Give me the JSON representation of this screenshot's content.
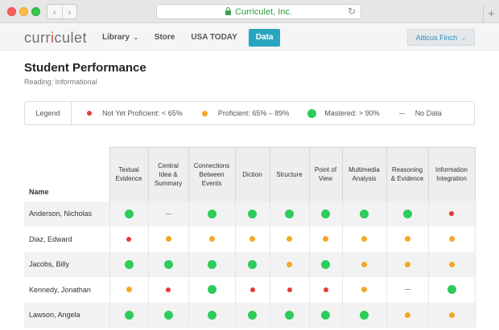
{
  "browser": {
    "url": "Curriculet, Inc.",
    "back_glyph": "‹",
    "forward_glyph": "›",
    "reload_glyph": "↻",
    "new_tab_glyph": "+"
  },
  "nav": {
    "logo_pre": "curr",
    "logo_accent": "i",
    "logo_post": "culet",
    "library": "Library",
    "store": "Store",
    "usa_today": "USA TODAY",
    "data": "Data",
    "user": "Atticus Finch",
    "caret": "⌄"
  },
  "page": {
    "title": "Student Performance",
    "subtitle": "Reading: Informational"
  },
  "legend": {
    "title": "Legend",
    "items": [
      {
        "mark": "red",
        "label": "Not Yet Proficient: < 65%"
      },
      {
        "mark": "yellow",
        "label": "Proficient: 65% – 89%"
      },
      {
        "mark": "green",
        "label": "Mastered: > 90%"
      },
      {
        "mark": "dash",
        "label": "No Data"
      }
    ]
  },
  "colors": {
    "red": "#e53935",
    "yellow": "#f5a623",
    "green": "#2ecc5a",
    "accent": "#29a6bf"
  },
  "table": {
    "name_header": "Name",
    "columns": [
      [
        "Textual",
        "Evidence"
      ],
      [
        "Central",
        "Idea &",
        "Summary"
      ],
      [
        "Connections",
        "Between",
        "Events"
      ],
      [
        "Diction"
      ],
      [
        "Structure"
      ],
      [
        "Point of",
        "View"
      ],
      [
        "Multimedia",
        "Analysis"
      ],
      [
        "Reasoning",
        "& Evidence"
      ],
      [
        "Information",
        "Integration"
      ]
    ],
    "rows": [
      {
        "name": "Anderson, Nicholas",
        "marks": [
          "green",
          "dash",
          "green",
          "green",
          "green",
          "green",
          "green",
          "green",
          "red"
        ]
      },
      {
        "name": "Diaz, Edward",
        "marks": [
          "red",
          "yellow",
          "yellow",
          "yellow",
          "yellow",
          "yellow",
          "yellow",
          "yellow",
          "yellow"
        ]
      },
      {
        "name": "Jacobs, Billy",
        "marks": [
          "green",
          "green",
          "green",
          "green",
          "yellow",
          "green",
          "yellow",
          "yellow",
          "yellow"
        ]
      },
      {
        "name": "Kennedy, Jonathan",
        "marks": [
          "yellow",
          "red",
          "green",
          "red",
          "red",
          "red",
          "yellow",
          "dash",
          "green"
        ]
      },
      {
        "name": "Lawson, Angela",
        "marks": [
          "green",
          "green",
          "green",
          "green",
          "green",
          "green",
          "green",
          "yellow",
          "yellow"
        ]
      }
    ]
  }
}
